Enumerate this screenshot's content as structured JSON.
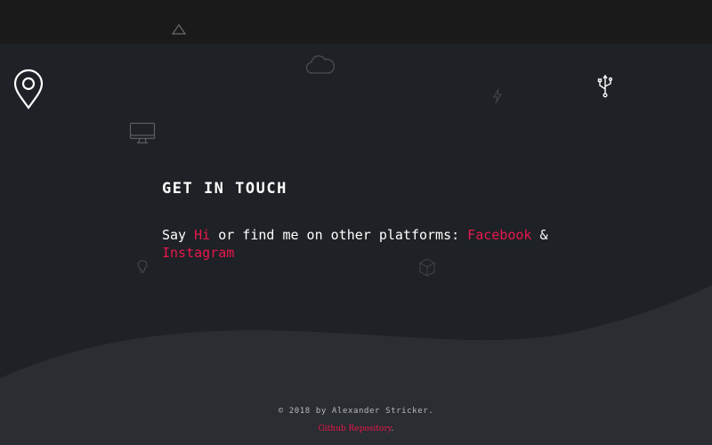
{
  "contact": {
    "heading": "GET IN TOUCH",
    "intro": {
      "prefix": "Say ",
      "hi": "Hi",
      "middle": " or find me on other platforms: ",
      "facebook": "Facebook",
      "separator": " & ",
      "instagram": "Instagram"
    }
  },
  "footer": {
    "copyright": "© 2018 by Alexander Stricker.",
    "repo_link": "Github Repository",
    "repo_suffix": "."
  },
  "icons": [
    "location-pin-icon",
    "triangle-icon",
    "cloud-icon",
    "lightning-icon",
    "usb-icon",
    "monitor-icon",
    "lightbulb-icon",
    "cube-icon"
  ],
  "colors": {
    "background": "#1e2125",
    "topbar": "#1a1a1a",
    "wave": "#2a2d32",
    "accent": "#e8174d",
    "text": "#ffffff",
    "muted": "#b8b8b8"
  }
}
